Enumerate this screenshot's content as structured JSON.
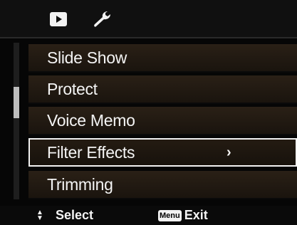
{
  "tabs": [
    {
      "icon": "playback-icon",
      "active": true
    },
    {
      "icon": "wrench-icon",
      "active": false
    }
  ],
  "menu": {
    "items": [
      {
        "label": "Slide Show",
        "selected": false
      },
      {
        "label": "Protect",
        "selected": false
      },
      {
        "label": "Voice Memo",
        "selected": false
      },
      {
        "label": "Filter Effects",
        "selected": true,
        "submenu_indicator": "›"
      },
      {
        "label": "Trimming",
        "selected": false
      }
    ],
    "scroll_position": 0.35
  },
  "footer": {
    "select_label": "Select",
    "menu_badge": "Menu",
    "exit_label": "Exit"
  },
  "colors": {
    "background": "#060606",
    "item_bg": "#2a2016",
    "text": "#f4f4f4",
    "highlight_border": "#f2f2f2"
  }
}
